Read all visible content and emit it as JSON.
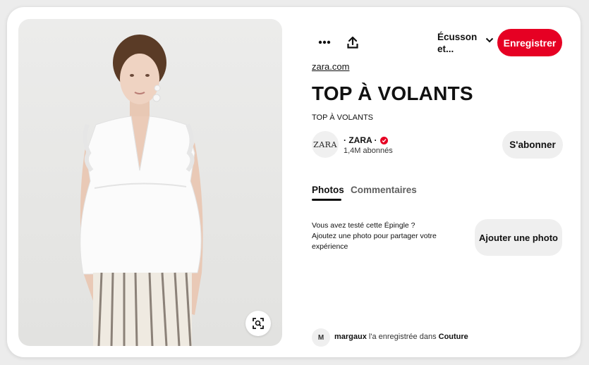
{
  "toolbar": {
    "more_icon": "more-horizontal-icon",
    "share_icon": "upload-share-icon",
    "board_label": "Écusson et...",
    "save_label": "Enregistrer"
  },
  "pin": {
    "image_alt": "Model wearing white ruffled sleeveless top with striped trousers",
    "source_link": "zara.com",
    "title": "TOP À VOLANTS",
    "description": "TOP À VOLANTS",
    "visual_search_icon": "lens-search-icon"
  },
  "creator": {
    "avatar_text": "ZARA",
    "name": "· ZARA ·",
    "followers": "1,4M abonnés",
    "follow_label": "S'abonner"
  },
  "tabs": [
    {
      "label": "Photos",
      "active": true
    },
    {
      "label": "Commentaires",
      "active": false
    }
  ],
  "tried": {
    "line1": "Vous avez testé cette Épingle ?",
    "line2": "Ajoutez une photo pour partager votre expérience",
    "button_label": "Ajouter une photo"
  },
  "saved_by": {
    "avatar_letter": "M",
    "user": "margaux",
    "text": " l'a enregistrée dans ",
    "board": "Couture"
  },
  "colors": {
    "brand_red": "#e60023",
    "button_gray": "#efefef"
  }
}
